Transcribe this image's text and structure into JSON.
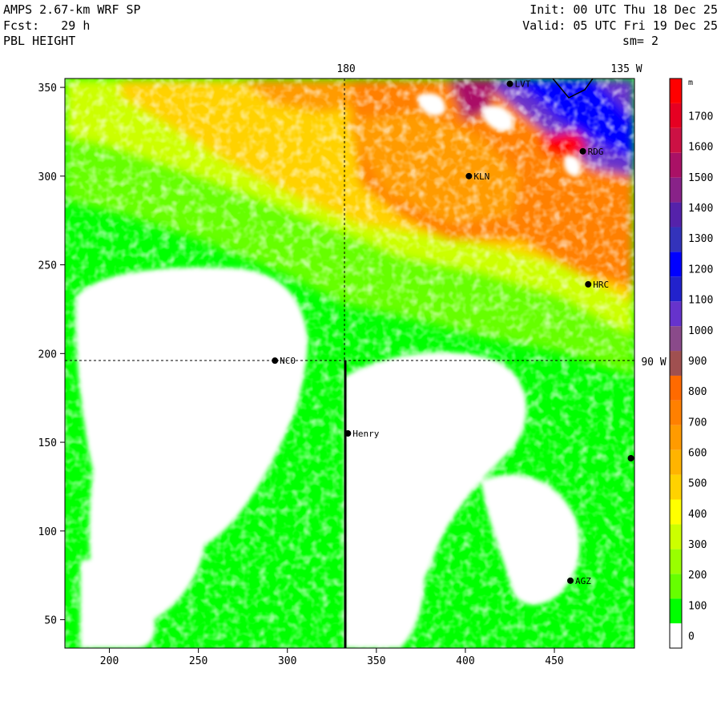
{
  "header": {
    "model": "AMPS 2.67-km WRF SP",
    "fcst": "Fcst:   29 h",
    "field": "PBL HEIGHT",
    "init": "Init: 00 UTC Thu 18 Dec 25",
    "valid": "Valid: 05 UTC Fri 19 Dec 25",
    "smoothing": "sm= 2"
  },
  "map": {
    "x_ticks": [
      "200",
      "250",
      "300",
      "350",
      "400",
      "450"
    ],
    "y_ticks": [
      "50",
      "100",
      "150",
      "200",
      "250",
      "300",
      "350"
    ],
    "x_range": [
      175,
      495
    ],
    "y_range": [
      34,
      355
    ],
    "meridian_labels": {
      "top_180": "180",
      "top_135w": "135 W",
      "right_90w": "90 W"
    },
    "stations": [
      {
        "name": "LVT",
        "label": "LVT",
        "x": 425,
        "y": 352
      },
      {
        "name": "RDG",
        "label": "RDG",
        "x": 466,
        "y": 314
      },
      {
        "name": "KLN",
        "label": "KLN",
        "x": 402,
        "y": 300
      },
      {
        "name": "HRC",
        "label": "HRC",
        "x": 469,
        "y": 239
      },
      {
        "name": "NCO",
        "label": "NCO",
        "x": 293,
        "y": 196
      },
      {
        "name": "Henry",
        "label": "Henry",
        "x": 334,
        "y": 155
      },
      {
        "name": "edge",
        "label": "",
        "x": 493,
        "y": 141
      },
      {
        "name": "AGZ",
        "label": "AGZ",
        "x": 459,
        "y": 72
      }
    ]
  },
  "colorbar": {
    "unit": "m",
    "labels": [
      "0",
      "100",
      "200",
      "300",
      "400",
      "500",
      "600",
      "700",
      "800",
      "900",
      "1000",
      "1100",
      "1200",
      "1300",
      "1400",
      "1500",
      "1600",
      "1700"
    ],
    "colors": [
      "#ffffff",
      "#00ff00",
      "#66ff00",
      "#99ff00",
      "#ccff00",
      "#ffff00",
      "#ffd200",
      "#ffb400",
      "#ff9b00",
      "#ff8000",
      "#ff6a00",
      "#a05050",
      "#8a4a8a",
      "#6633cc",
      "#2222cc",
      "#0000ff",
      "#3333bb",
      "#5522aa",
      "#882288",
      "#aa1166",
      "#cc1144",
      "#e60022",
      "#ff0000"
    ]
  }
}
